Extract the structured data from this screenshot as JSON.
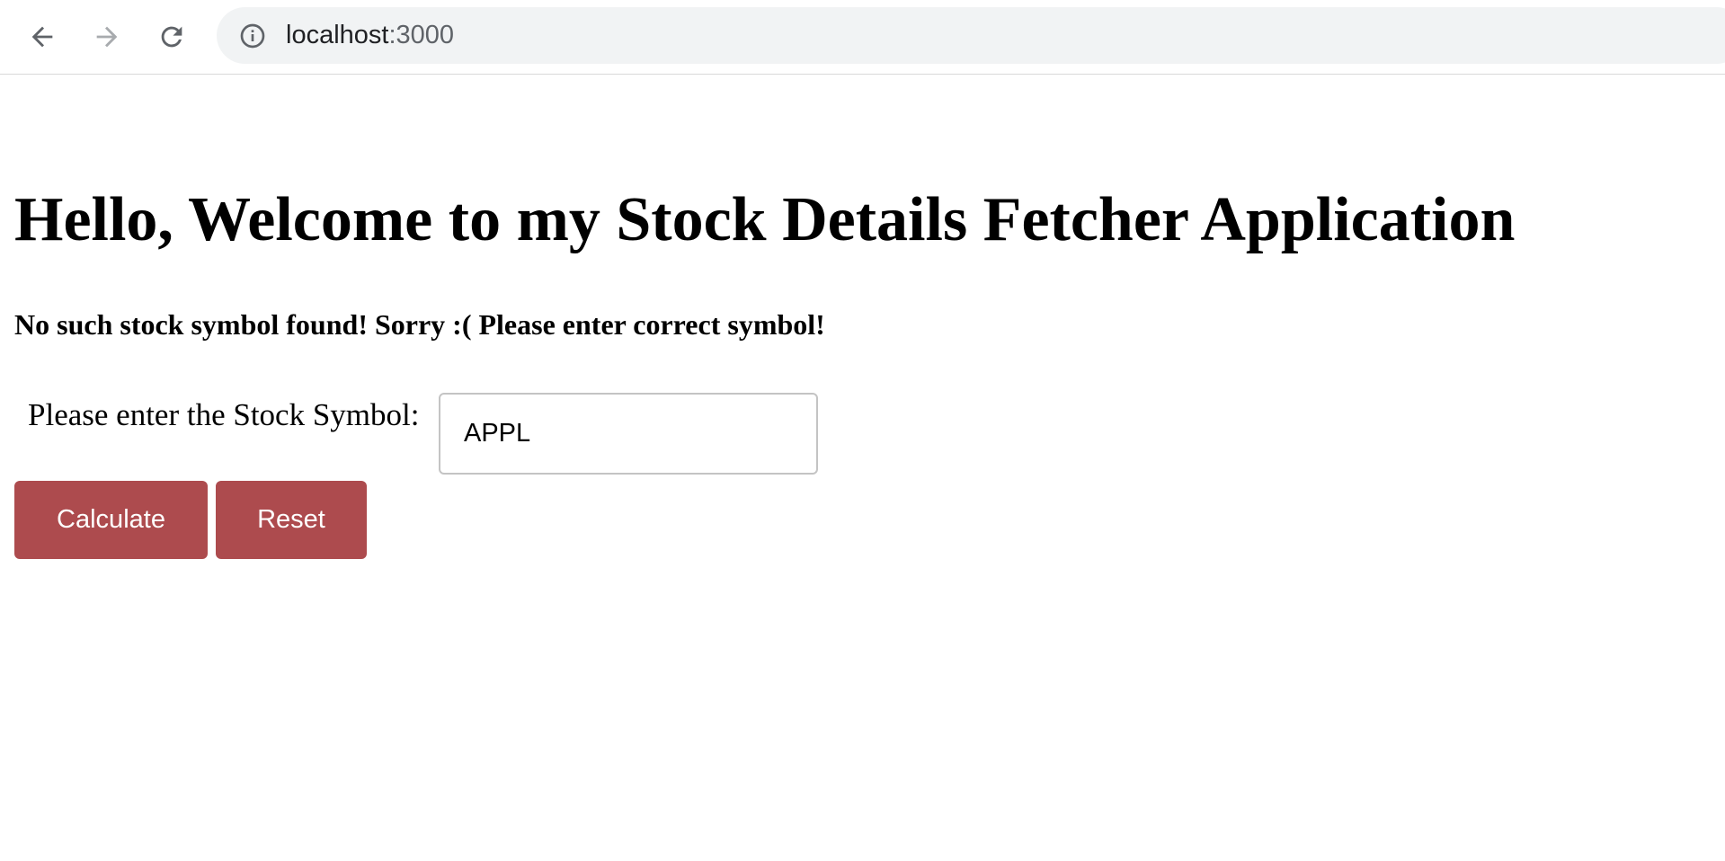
{
  "browser": {
    "url_host": "localhost",
    "url_port": ":3000",
    "icons": {
      "back": "arrow-left-icon",
      "forward": "arrow-right-icon",
      "reload": "reload-icon",
      "info": "info-icon"
    }
  },
  "page": {
    "title": "Hello, Welcome to my Stock Details Fetcher Application",
    "error_message": "No such stock symbol found! Sorry :( Please enter correct symbol!",
    "form": {
      "label": "Please enter the Stock Symbol:",
      "symbol_value": "APPL",
      "calculate_label": "Calculate",
      "reset_label": "Reset"
    }
  },
  "colors": {
    "button_bg": "#ad4b4e",
    "button_text": "#ffffff",
    "omnibox_bg": "#f1f3f4"
  }
}
